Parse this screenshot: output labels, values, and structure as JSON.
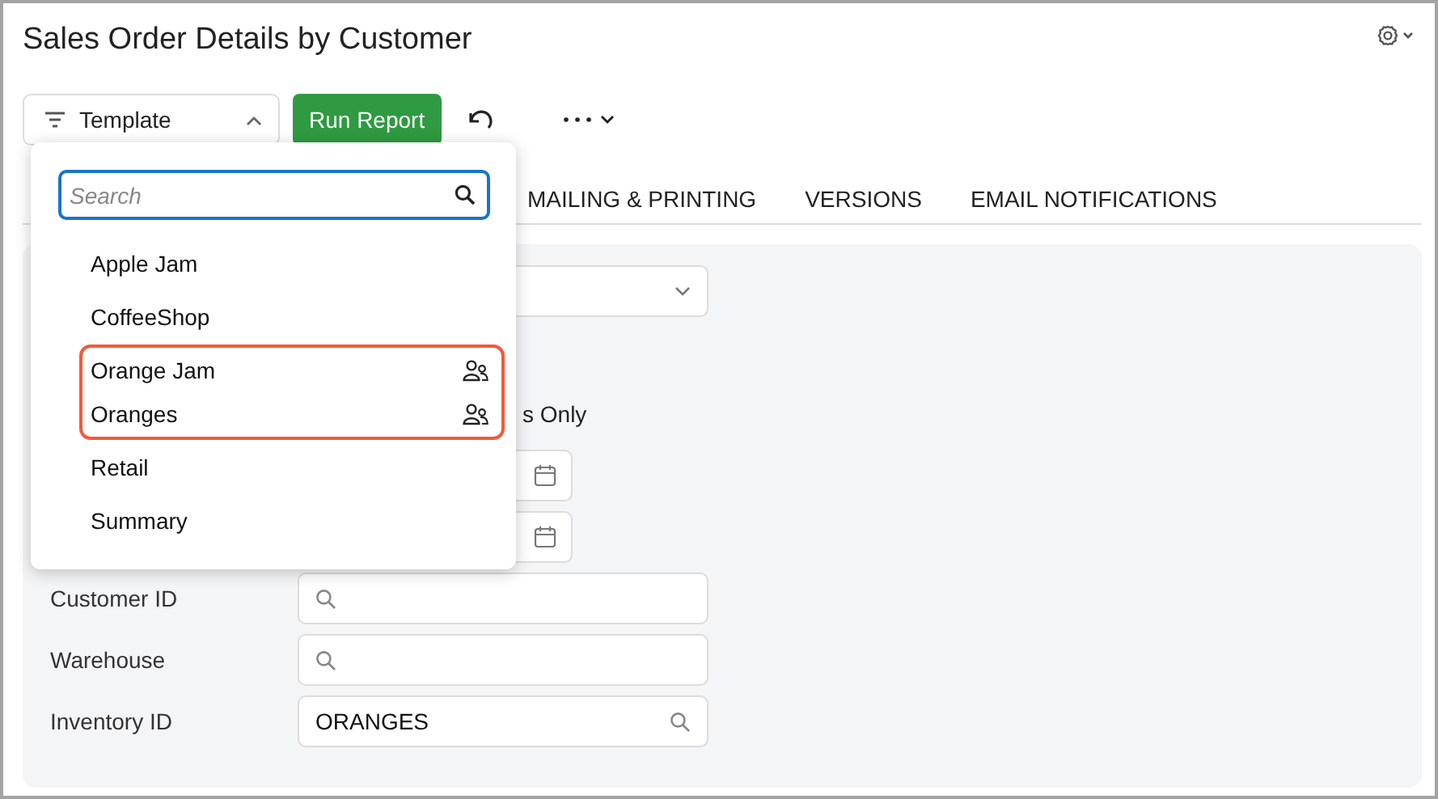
{
  "title": "Sales Order Details by Customer",
  "toolbar": {
    "template_button": "Template",
    "run_button": "Run Report"
  },
  "tabs": [
    {
      "label": "MAILING & PRINTING",
      "selected": false
    },
    {
      "label": "VERSIONS",
      "selected": false
    },
    {
      "label": "EMAIL NOTIFICATIONS",
      "selected": false
    }
  ],
  "form_rows": [
    {
      "kind": "select"
    },
    {
      "kind": "text",
      "text": "s Only"
    },
    {
      "kind": "date"
    },
    {
      "kind": "date"
    },
    {
      "kind": "lookup",
      "label": "Customer ID"
    },
    {
      "kind": "lookup",
      "label": "Warehouse"
    },
    {
      "kind": "lookup",
      "label": "Inventory ID",
      "value": "ORANGES"
    }
  ],
  "template_menu": {
    "search": {
      "placeholder": "Search"
    },
    "items": [
      {
        "label": "Apple Jam",
        "shared": false,
        "highlighted": false
      },
      {
        "label": "CoffeeShop",
        "shared": false,
        "highlighted": false
      },
      {
        "label": "Orange Jam",
        "shared": true,
        "highlighted": true
      },
      {
        "label": "Oranges",
        "shared": true,
        "highlighted": true
      },
      {
        "label": "Retail",
        "shared": false,
        "highlighted": false
      },
      {
        "label": "Summary",
        "shared": false,
        "highlighted": false
      }
    ]
  }
}
